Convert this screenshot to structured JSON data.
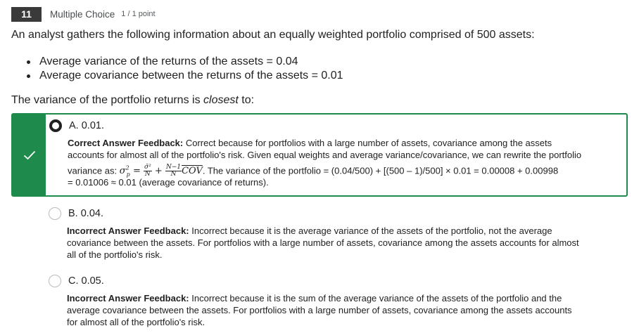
{
  "question": {
    "number": "11",
    "type": "Multiple Choice",
    "points": "1 / 1 point",
    "stem": "An analyst gathers the following information about an equally weighted portfolio comprised of 500 assets:",
    "bullets": [
      "Average variance of the returns of the assets = 0.04",
      "Average covariance between the returns of the assets = 0.01"
    ],
    "prompt_before": "The variance of the portfolio returns is ",
    "prompt_emph": "closest",
    "prompt_after": " to:"
  },
  "options": [
    {
      "label": "A. 0.01.",
      "state": "selected-correct",
      "feedback_title": "Correct Answer Feedback:",
      "feedback_lines": [
        " Correct because for portfolios with a large number of assets, covariance among the assets",
        "accounts for almost all of the portfolio's risk. Given equal weights and average variance/covariance, we can rewrite the portfolio",
        "variance as: ",
        ". The variance of the portfolio = (0.04/500) + [(500 – 1)/500] × 0.01 = 0.00008 + 0.00998",
        "= 0.01006 ≈ 0.01 (average covariance of returns)."
      ],
      "formula": {
        "lhs": "σ",
        "lhs_sup": "2",
        "lhs_sub": "p",
        "eq": "=",
        "f1_num": "σ̄²",
        "f1_den": "N",
        "plus": "+",
        "f2_num": "N−1",
        "f2_den": "N",
        "cov": "COV"
      }
    },
    {
      "label": "B. 0.04.",
      "state": "unselected",
      "feedback_title": "Incorrect Answer Feedback:",
      "feedback_lines": [
        " Incorrect because it is the average variance of the assets of the portfolio, not the average",
        "covariance between the assets. For portfolios with a large number of assets, covariance among the assets accounts for almost",
        "all of the portfolio's risk."
      ]
    },
    {
      "label": "C. 0.05.",
      "state": "unselected",
      "feedback_title": "Incorrect Answer Feedback:",
      "feedback_lines": [
        " Incorrect because it is the sum of the average variance of the assets of the portfolio and the",
        "average covariance between the assets. For portfolios with a large number of assets, covariance among the assets accounts",
        "for almost all of the portfolio's risk."
      ]
    }
  ],
  "colors": {
    "correct": "#1e8a4c",
    "header_badge": "#3a3a3a"
  },
  "icons": {
    "correct_indicator": "checkmark-icon",
    "radio": "radio-button"
  }
}
